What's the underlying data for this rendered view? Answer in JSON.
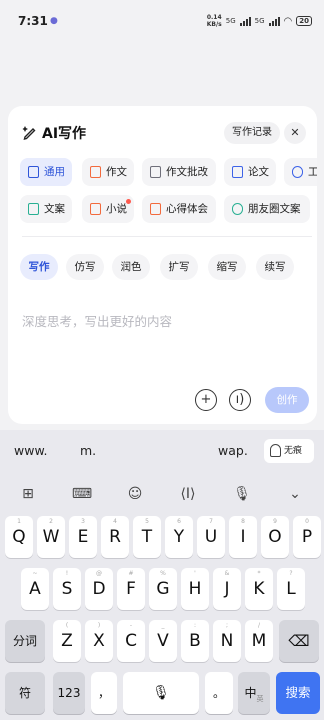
{
  "status": {
    "time": "7:31",
    "speed_value": "0.14",
    "speed_unit": "KB/s",
    "net1": "5G",
    "net2": "5G",
    "battery": "20"
  },
  "card": {
    "title": "AI写作",
    "records": "写作记录",
    "close": "✕",
    "categories": [
      "通用",
      "作文",
      "作文批改",
      "论文",
      "工",
      "文案",
      "小说",
      "心得体会",
      "朋友圈文案"
    ],
    "modes": [
      "写作",
      "仿写",
      "润色",
      "扩写",
      "缩写",
      "续写"
    ],
    "placeholder": "深度思考，写出更好的内容",
    "send": "创作"
  },
  "keyboard": {
    "suggestions": [
      "www.",
      "m.",
      "wap."
    ],
    "no_trace": "无痕",
    "row1": [
      {
        "k": "Q",
        "s": "1"
      },
      {
        "k": "W",
        "s": "2"
      },
      {
        "k": "E",
        "s": "3"
      },
      {
        "k": "R",
        "s": "4"
      },
      {
        "k": "T",
        "s": "5"
      },
      {
        "k": "Y",
        "s": "6"
      },
      {
        "k": "U",
        "s": "7"
      },
      {
        "k": "I",
        "s": "8"
      },
      {
        "k": "O",
        "s": "9"
      },
      {
        "k": "P",
        "s": "0"
      }
    ],
    "row2": [
      {
        "k": "A",
        "s": "~"
      },
      {
        "k": "S",
        "s": "!"
      },
      {
        "k": "D",
        "s": "@"
      },
      {
        "k": "F",
        "s": "#"
      },
      {
        "k": "G",
        "s": "%"
      },
      {
        "k": "H",
        "s": "'"
      },
      {
        "k": "J",
        "s": "&"
      },
      {
        "k": "K",
        "s": "*"
      },
      {
        "k": "L",
        "s": "?"
      }
    ],
    "row3": [
      {
        "k": "Z",
        "s": "("
      },
      {
        "k": "X",
        "s": ")"
      },
      {
        "k": "C",
        "s": "-"
      },
      {
        "k": "V",
        "s": "_"
      },
      {
        "k": "B",
        "s": ":"
      },
      {
        "k": "N",
        "s": ";"
      },
      {
        "k": "M",
        "s": "/"
      }
    ],
    "segment": "分词",
    "symbols": "符",
    "numbers": "123",
    "comma": "，",
    "period": "。",
    "lang": "中",
    "lang_sub": "英",
    "search": "搜索"
  },
  "colors": {
    "accent": "#2f55d8",
    "active_bg": "#e8ecfd",
    "search_key": "#3f74f2"
  }
}
